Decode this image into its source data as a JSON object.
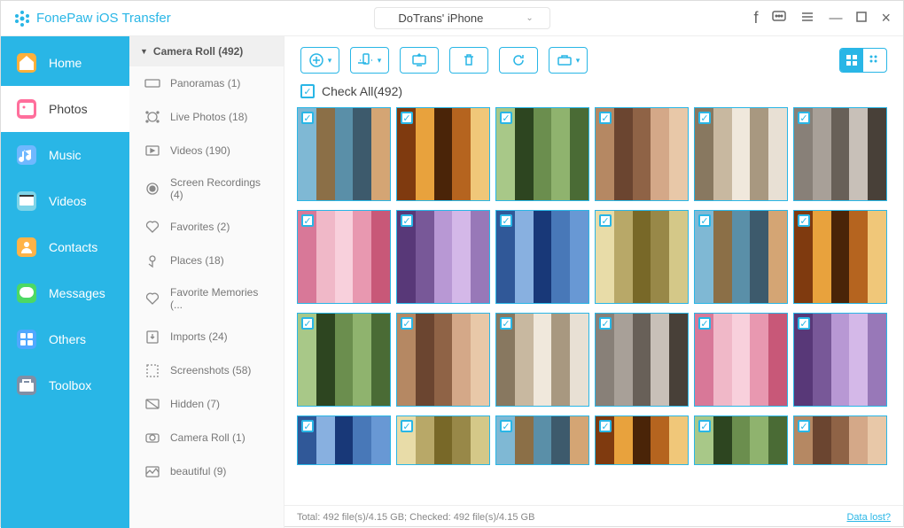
{
  "app_title": "FonePaw iOS Transfer",
  "device": "DoTrans' iPhone",
  "nav": [
    {
      "label": "Home",
      "icon": "home",
      "color": "#ffb03a"
    },
    {
      "label": "Photos",
      "icon": "photo",
      "color": "#ff6f9c"
    },
    {
      "label": "Music",
      "icon": "music",
      "color": "#6fb8ff"
    },
    {
      "label": "Videos",
      "icon": "video",
      "color": "#7fd4e8"
    },
    {
      "label": "Contacts",
      "icon": "contact",
      "color": "#ffb347"
    },
    {
      "label": "Messages",
      "icon": "msg",
      "color": "#4cd964"
    },
    {
      "label": "Others",
      "icon": "other",
      "color": "#4fa8ff"
    },
    {
      "label": "Toolbox",
      "icon": "tool",
      "color": "#7f8fa6"
    }
  ],
  "nav_active": 1,
  "album_header": "Camera Roll (492)",
  "albums": [
    {
      "label": "Panoramas (1)"
    },
    {
      "label": "Live Photos (18)"
    },
    {
      "label": "Videos (190)"
    },
    {
      "label": "Screen Recordings (4)"
    },
    {
      "label": "Favorites (2)"
    },
    {
      "label": "Places (18)"
    },
    {
      "label": "Favorite Memories (..."
    },
    {
      "label": "Imports (24)"
    },
    {
      "label": "Screenshots (58)"
    },
    {
      "label": "Hidden (7)"
    },
    {
      "label": "Camera Roll (1)"
    },
    {
      "label": "beautiful (9)"
    }
  ],
  "check_all": "Check All(492)",
  "status_text": "Total: 492 file(s)/4.15 GB; Checked: 492 file(s)/4.15 GB",
  "data_lost": "Data lost?",
  "grid_rows": 4,
  "grid_cols": 6
}
